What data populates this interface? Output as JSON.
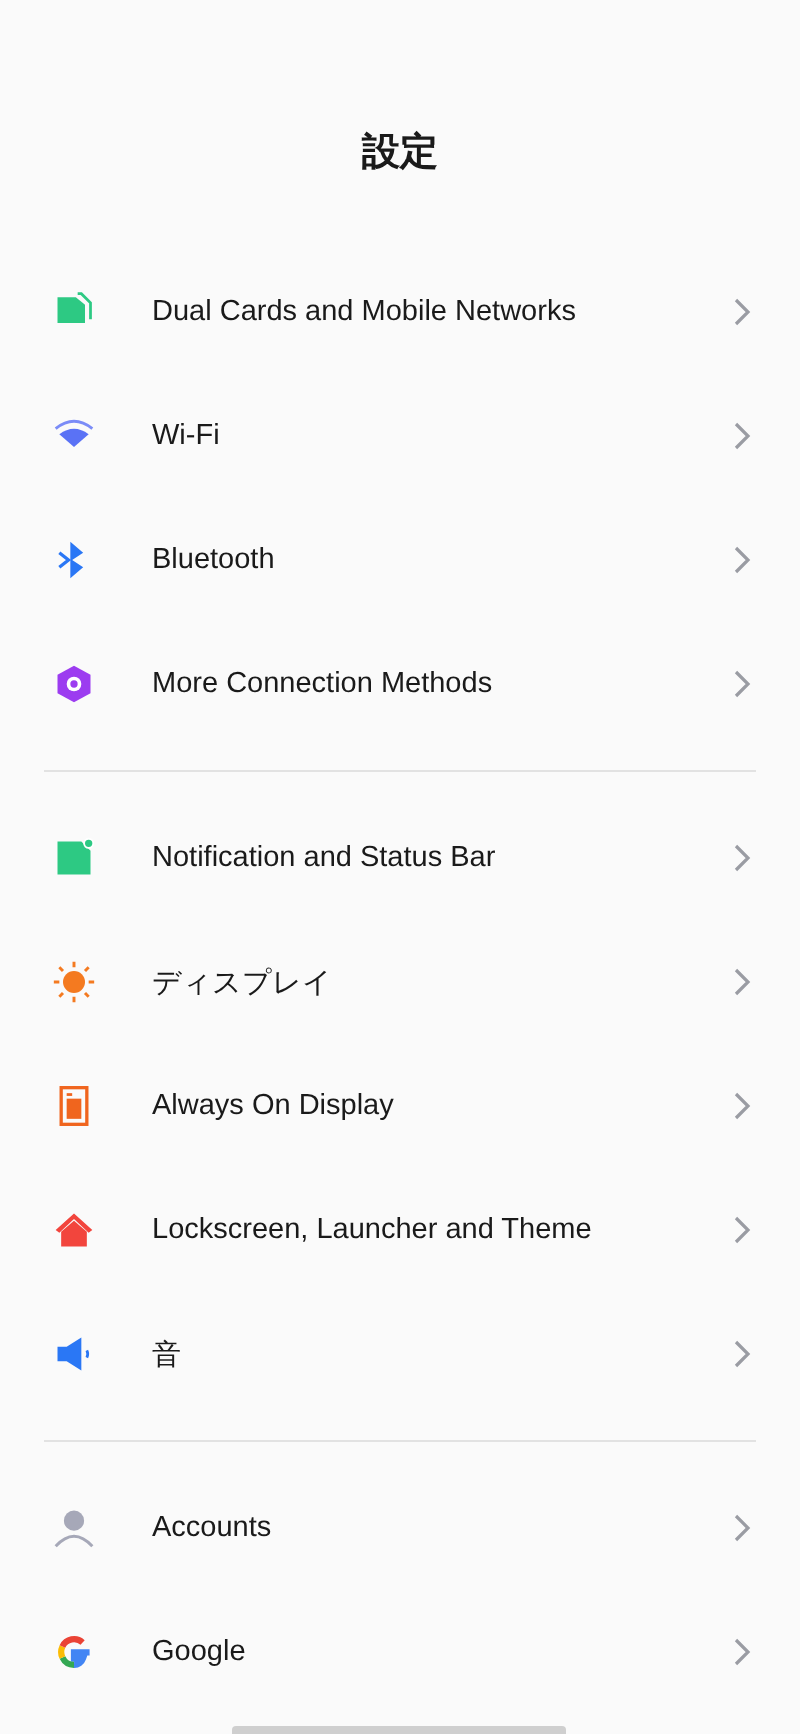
{
  "title": "設定",
  "sections": [
    {
      "items": [
        {
          "kind": "sim",
          "label": "Dual Cards and Mobile Networks"
        },
        {
          "kind": "wifi",
          "label": "Wi-Fi"
        },
        {
          "kind": "bluetooth",
          "label": "Bluetooth"
        },
        {
          "kind": "connection",
          "label": "More Connection Methods"
        }
      ]
    },
    {
      "items": [
        {
          "kind": "notification",
          "label": "Notification and Status Bar"
        },
        {
          "kind": "display",
          "label": "ディスプレイ"
        },
        {
          "kind": "aod",
          "label": "Always On Display"
        },
        {
          "kind": "theme",
          "label": "Lockscreen, Launcher and Theme"
        },
        {
          "kind": "sound",
          "label": "音"
        }
      ]
    },
    {
      "items": [
        {
          "kind": "account",
          "label": "Accounts"
        },
        {
          "kind": "google",
          "label": "Google"
        }
      ]
    }
  ]
}
